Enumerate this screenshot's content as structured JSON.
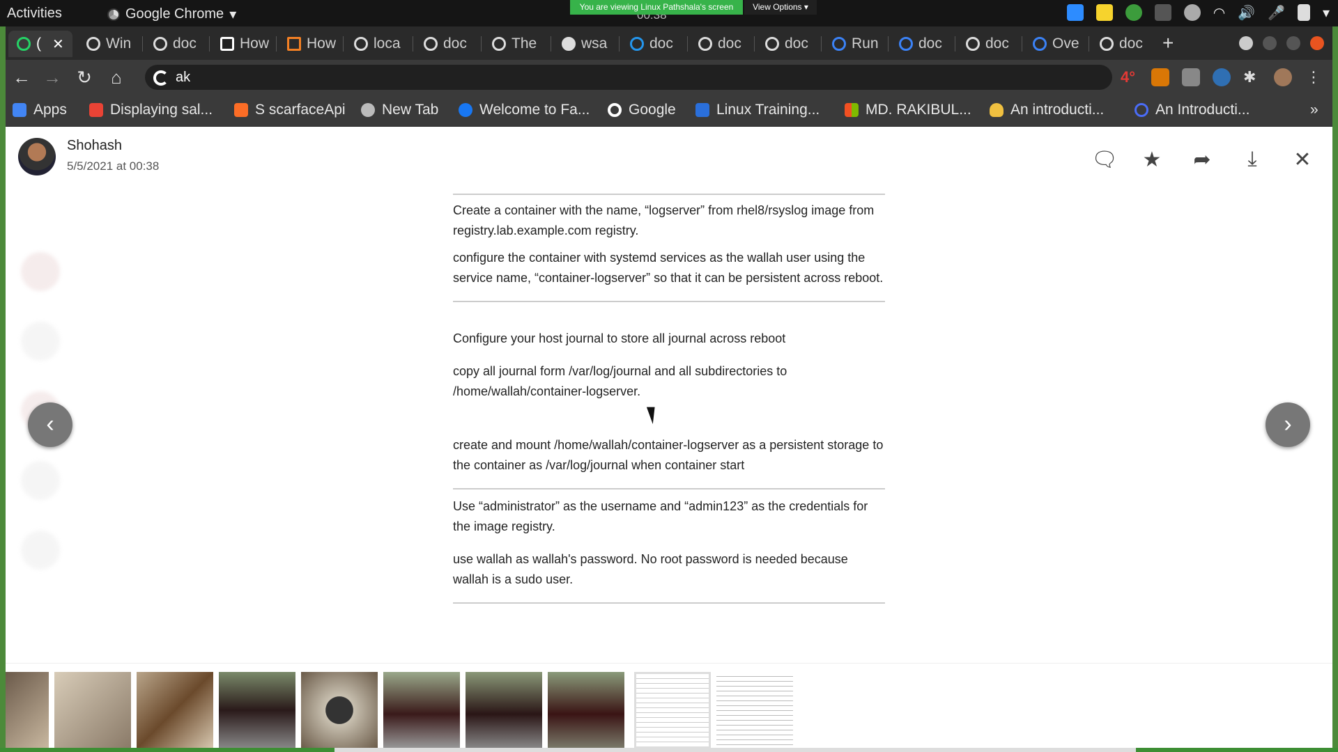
{
  "system": {
    "activities": "Activities",
    "app_name": "Google Chrome",
    "share_banner": "You are viewing Linux Pathshala's screen",
    "view_options": "View Options",
    "clock": "00:38",
    "tray_icons": [
      "zoom-icon",
      "notes-icon",
      "vpn-icon",
      "a-icon",
      "status-icon",
      "wifi-icon",
      "volume-icon",
      "mic-icon",
      "battery-icon",
      "menu-icon"
    ]
  },
  "tabs": [
    {
      "label": "(",
      "icon": "whatsapp-icon",
      "active": true
    },
    {
      "label": "Win",
      "icon": "globe-icon"
    },
    {
      "label": "doc",
      "icon": "google-icon"
    },
    {
      "label": "How",
      "icon": "site-icon"
    },
    {
      "label": "How",
      "icon": "stackoverflow-icon"
    },
    {
      "label": "loca",
      "icon": "globe-icon"
    },
    {
      "label": "doc",
      "icon": "google-icon"
    },
    {
      "label": "The",
      "icon": "globe-icon"
    },
    {
      "label": "wsa",
      "icon": "github-icon"
    },
    {
      "label": "doc",
      "icon": "docker-icon"
    },
    {
      "label": "doc",
      "icon": "google-icon"
    },
    {
      "label": "doc",
      "icon": "google-icon"
    },
    {
      "label": "Run",
      "icon": "site-icon"
    },
    {
      "label": "doc",
      "icon": "site-icon"
    },
    {
      "label": "doc",
      "icon": "google-icon"
    },
    {
      "label": "Ove",
      "icon": "site-icon"
    },
    {
      "label": "doc",
      "icon": "google-icon"
    }
  ],
  "toolbar": {
    "address": "ak",
    "weather": "4°"
  },
  "bookmarks": [
    {
      "label": "Apps",
      "color": "#4285f4"
    },
    {
      "label": "Displaying sal...",
      "color": "#ea4335"
    },
    {
      "label": "S scarfaceApi",
      "color": "#fc6d26"
    },
    {
      "label": "New Tab",
      "color": "#bbbbbb"
    },
    {
      "label": "Welcome to Fa...",
      "color": "#1877f2"
    },
    {
      "label": "Google",
      "color": "#ffffff"
    },
    {
      "label": "Linux Training...",
      "color": "#2a6fdb"
    },
    {
      "label": "MD. RAKIBUL...",
      "color": "#f25022"
    },
    {
      "label": "An introducti...",
      "color": "#f0c040"
    },
    {
      "label": "An Introducti...",
      "color": "#4a6cf7"
    }
  ],
  "viewer": {
    "sender_name": "Shohash",
    "timestamp": "5/5/2021 at 00:38",
    "paragraphs": [
      "Create a container with the name, “logserver” from rhel8/rsyslog image from registry.lab.example.com registry.",
      "configure the container with systemd services as the wallah user using the service name, “container-logserver” so that it can be persistent across reboot.",
      "Configure your host journal to store all journal across reboot",
      "copy all journal form /var/log/journal and all subdirectories to /home/wallah/container-logserver.",
      "create and mount /home/wallah/container-logserver as a persistent storage to the container as /var/log/journal when container start",
      "Use “administrator” as the username and “admin123” as the credentials for the image registry.",
      "use wallah as wallah's password. No root password is needed because wallah is a sudo user."
    ]
  }
}
